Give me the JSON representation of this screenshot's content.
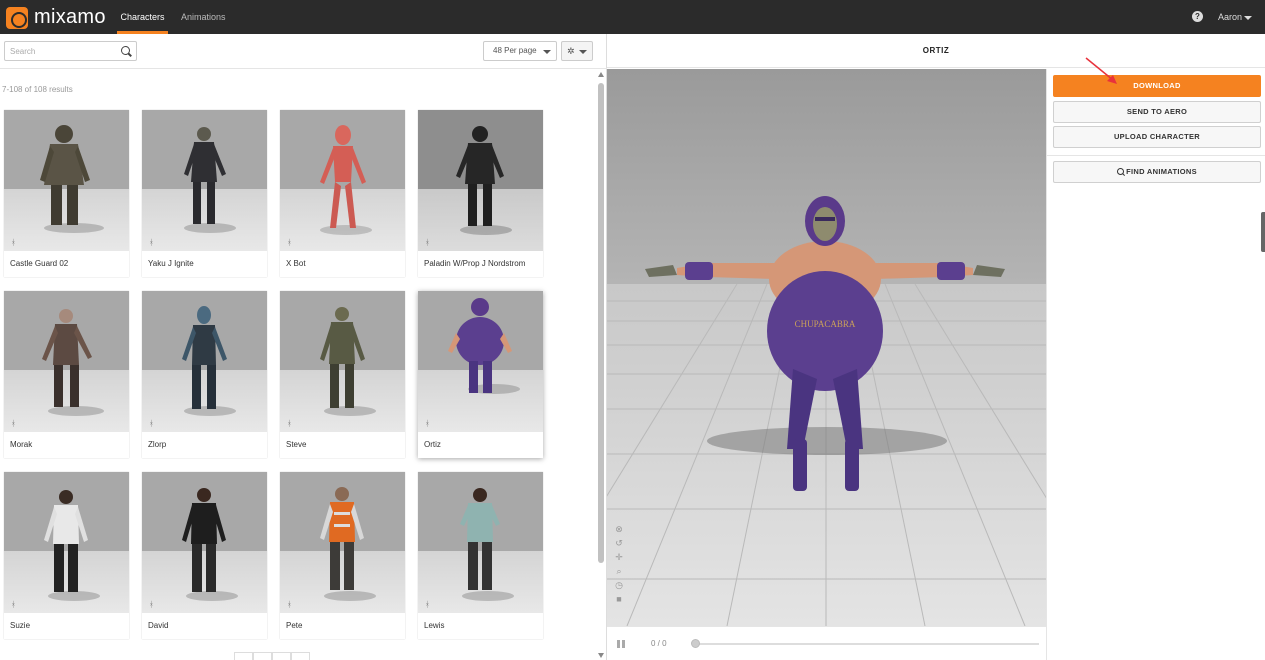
{
  "app": {
    "logo_text": "mixamo"
  },
  "nav": {
    "tabs": [
      {
        "label": "Characters",
        "active": true
      },
      {
        "label": "Animations",
        "active": false
      }
    ]
  },
  "user": {
    "name": "Aaron"
  },
  "toolbar": {
    "search_placeholder": "Search",
    "per_page": "48 Per page"
  },
  "results": {
    "text": "7-108 of 108 results"
  },
  "characters": [
    {
      "name": "Castle Guard 02"
    },
    {
      "name": "Yaku J Ignite"
    },
    {
      "name": "X Bot"
    },
    {
      "name": "Paladin W/Prop J Nordstrom"
    },
    {
      "name": "Morak"
    },
    {
      "name": "Zlorp"
    },
    {
      "name": "Steve"
    },
    {
      "name": "Ortiz",
      "selected": true
    },
    {
      "name": "Suzie"
    },
    {
      "name": "David"
    },
    {
      "name": "Pete"
    },
    {
      "name": "Lewis"
    }
  ],
  "viewer": {
    "title": "ORTIZ",
    "shirt_text": "CHUPACABRA",
    "frame_counter": "0 / 0"
  },
  "actions": {
    "download": "DOWNLOAD",
    "send_to_aero": "SEND TO AERO",
    "upload_character": "UPLOAD CHARACTER",
    "find_animations": "FIND ANIMATIONS"
  },
  "colors": {
    "accent": "#f58220",
    "topbar": "#2b2b2b",
    "annotation_arrow": "#e8323c"
  }
}
